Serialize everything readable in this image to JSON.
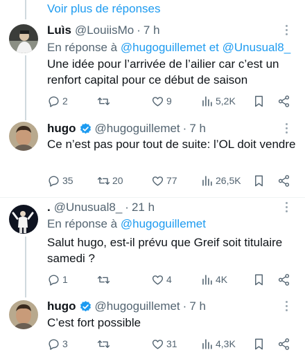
{
  "thread": {
    "show_more_label": "Voir plus de réponses",
    "reply_prefix": "En réponse à"
  },
  "colors": {
    "link": "#1d9bf0",
    "muted": "#536471",
    "verified": "#1d9bf0"
  },
  "tweets": [
    {
      "name": "Luìs",
      "handle": "@LouiisMo",
      "sep": "·",
      "time": "7 h",
      "verified": false,
      "reply_to_1": "@hugoguillemet",
      "reply_and": "et",
      "reply_to_2": "@Unusual8_",
      "text": "Une idée pour l’arrivée de l’ailier car c’est un renfort capital pour ce début de saison",
      "stats": {
        "replies": "2",
        "retweets": "",
        "likes": "9",
        "views": "5,2K"
      }
    },
    {
      "name": "hugo",
      "handle": "@hugoguillemet",
      "sep": "·",
      "time": "7 h",
      "verified": true,
      "text": "Ce n’est pas pour tout de suite: l’OL doit vendre",
      "stats": {
        "replies": "35",
        "retweets": "20",
        "likes": "77",
        "views": "26,5K"
      }
    },
    {
      "name": ".",
      "handle": "@Unusual8_",
      "sep": "·",
      "time": "21 h",
      "verified": false,
      "reply_to_1": "@hugoguillemet",
      "text": "Salut hugo, est-il prévu que Greif soit titulaire samedi ?",
      "stats": {
        "replies": "1",
        "retweets": "",
        "likes": "4",
        "views": "4K"
      }
    },
    {
      "name": "hugo",
      "handle": "@hugoguillemet",
      "sep": "·",
      "time": "7 h",
      "verified": true,
      "text": "C’est fort possible",
      "stats": {
        "replies": "3",
        "retweets": "",
        "likes": "31",
        "views": "4,3K"
      }
    }
  ],
  "icons": [
    "reply-icon",
    "retweet-icon",
    "like-icon",
    "views-icon",
    "bookmark-icon",
    "share-icon",
    "verified-badge-icon",
    "more-options-icon"
  ]
}
